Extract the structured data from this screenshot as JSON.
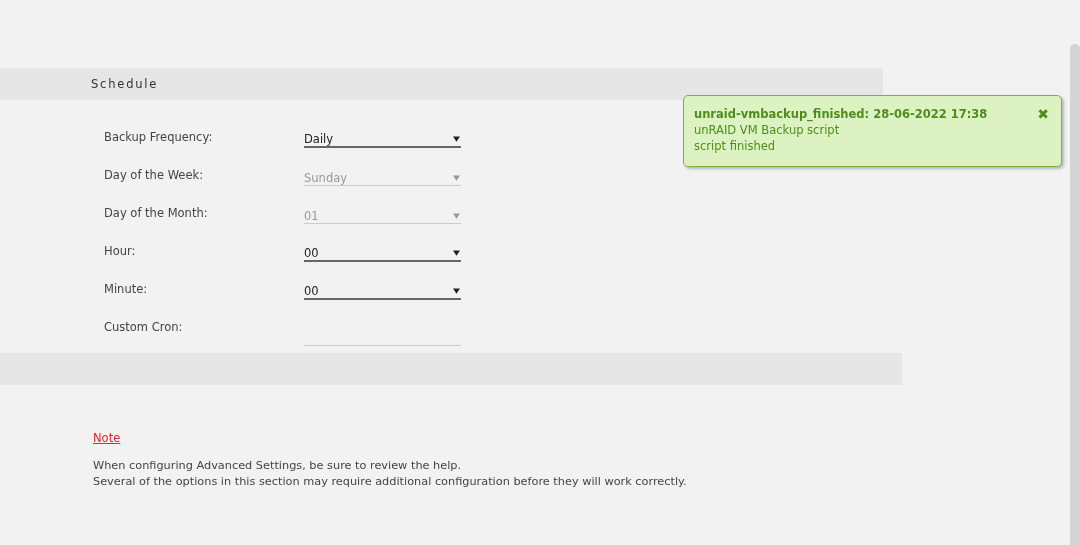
{
  "section": {
    "title": "Schedule"
  },
  "fields": [
    {
      "label": "Backup Frequency:",
      "kind": "select",
      "value": "Daily",
      "disabled": false
    },
    {
      "label": "Day of the Week:",
      "kind": "select",
      "value": "Sunday",
      "disabled": true
    },
    {
      "label": "Day of the Month:",
      "kind": "select",
      "value": "01",
      "disabled": true
    },
    {
      "label": "Hour:",
      "kind": "select",
      "value": "00",
      "disabled": false
    },
    {
      "label": "Minute:",
      "kind": "select",
      "value": "00",
      "disabled": false
    },
    {
      "label": "Custom Cron:",
      "kind": "text"
    }
  ],
  "note": {
    "link": "Note",
    "lines": [
      "When configuring Advanced Settings, be sure to review the help.",
      "Several of the options in this section may require additional configuration before they will work correctly."
    ]
  },
  "notification": {
    "title": "unraid-vmbackup_finished: 28-06-2022 17:38",
    "lines": [
      "unRAID VM Backup script",
      "script finished"
    ],
    "close": "✖"
  }
}
